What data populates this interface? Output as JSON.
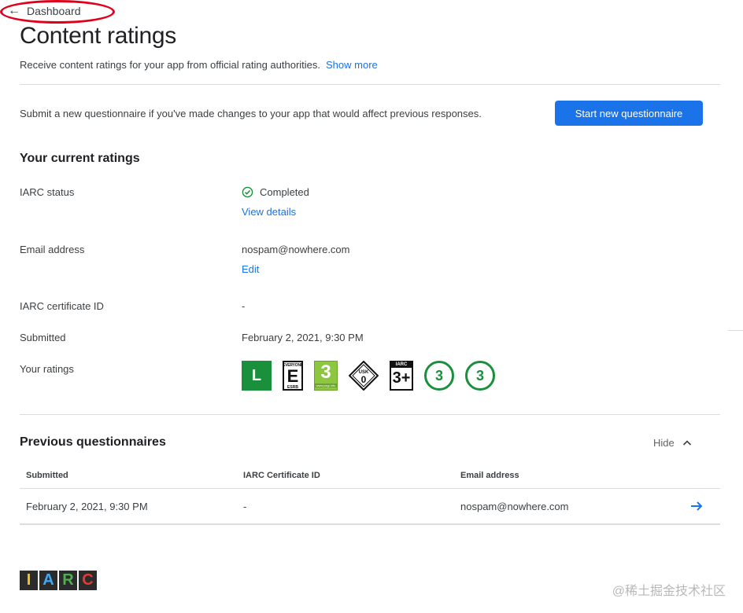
{
  "nav": {
    "back_label": "Dashboard"
  },
  "page": {
    "title": "Content ratings",
    "intro": "Receive content ratings for your app from official rating authorities.",
    "show_more": "Show more"
  },
  "questionnaire": {
    "text": "Submit a new questionnaire if you've made changes to your app that would affect previous responses.",
    "button": "Start new questionnaire"
  },
  "current": {
    "title": "Your current ratings",
    "iarc_status_label": "IARC status",
    "iarc_status_value": "Completed",
    "view_details": "View details",
    "email_label": "Email address",
    "email_value": "nospam@nowhere.com",
    "edit": "Edit",
    "cert_label": "IARC certificate ID",
    "cert_value": "-",
    "submitted_label": "Submitted",
    "submitted_value": "February 2, 2021, 9:30 PM",
    "ratings_label": "Your ratings",
    "ratings": {
      "classind": "L",
      "esrb_top": "EVERYONE",
      "esrb": "E",
      "esrb_bottom": "ESRB",
      "pegi": "3",
      "pegi_url": "www.pegi.info",
      "usk_top": "USK",
      "usk": "0",
      "iarc_top": "IARC",
      "iarc": "3+",
      "generic_1": "3",
      "generic_2": "3"
    }
  },
  "previous": {
    "title": "Previous questionnaires",
    "hide": "Hide",
    "columns": [
      "Submitted",
      "IARC Certificate ID",
      "Email address"
    ],
    "rows": [
      {
        "submitted": "February 2, 2021, 9:30 PM",
        "cert": "-",
        "email": "nospam@nowhere.com"
      }
    ]
  },
  "footer": {
    "logo_letters": [
      "I",
      "A",
      "R",
      "C"
    ],
    "logo_colors": [
      "#f5c518",
      "#3fa9f5",
      "#4caf50",
      "#e53935"
    ],
    "watermark": "@稀土掘金技术社区"
  },
  "colors": {
    "accent": "#1a73e8",
    "success": "#1a8f3c",
    "annotation": "#e0001b"
  }
}
